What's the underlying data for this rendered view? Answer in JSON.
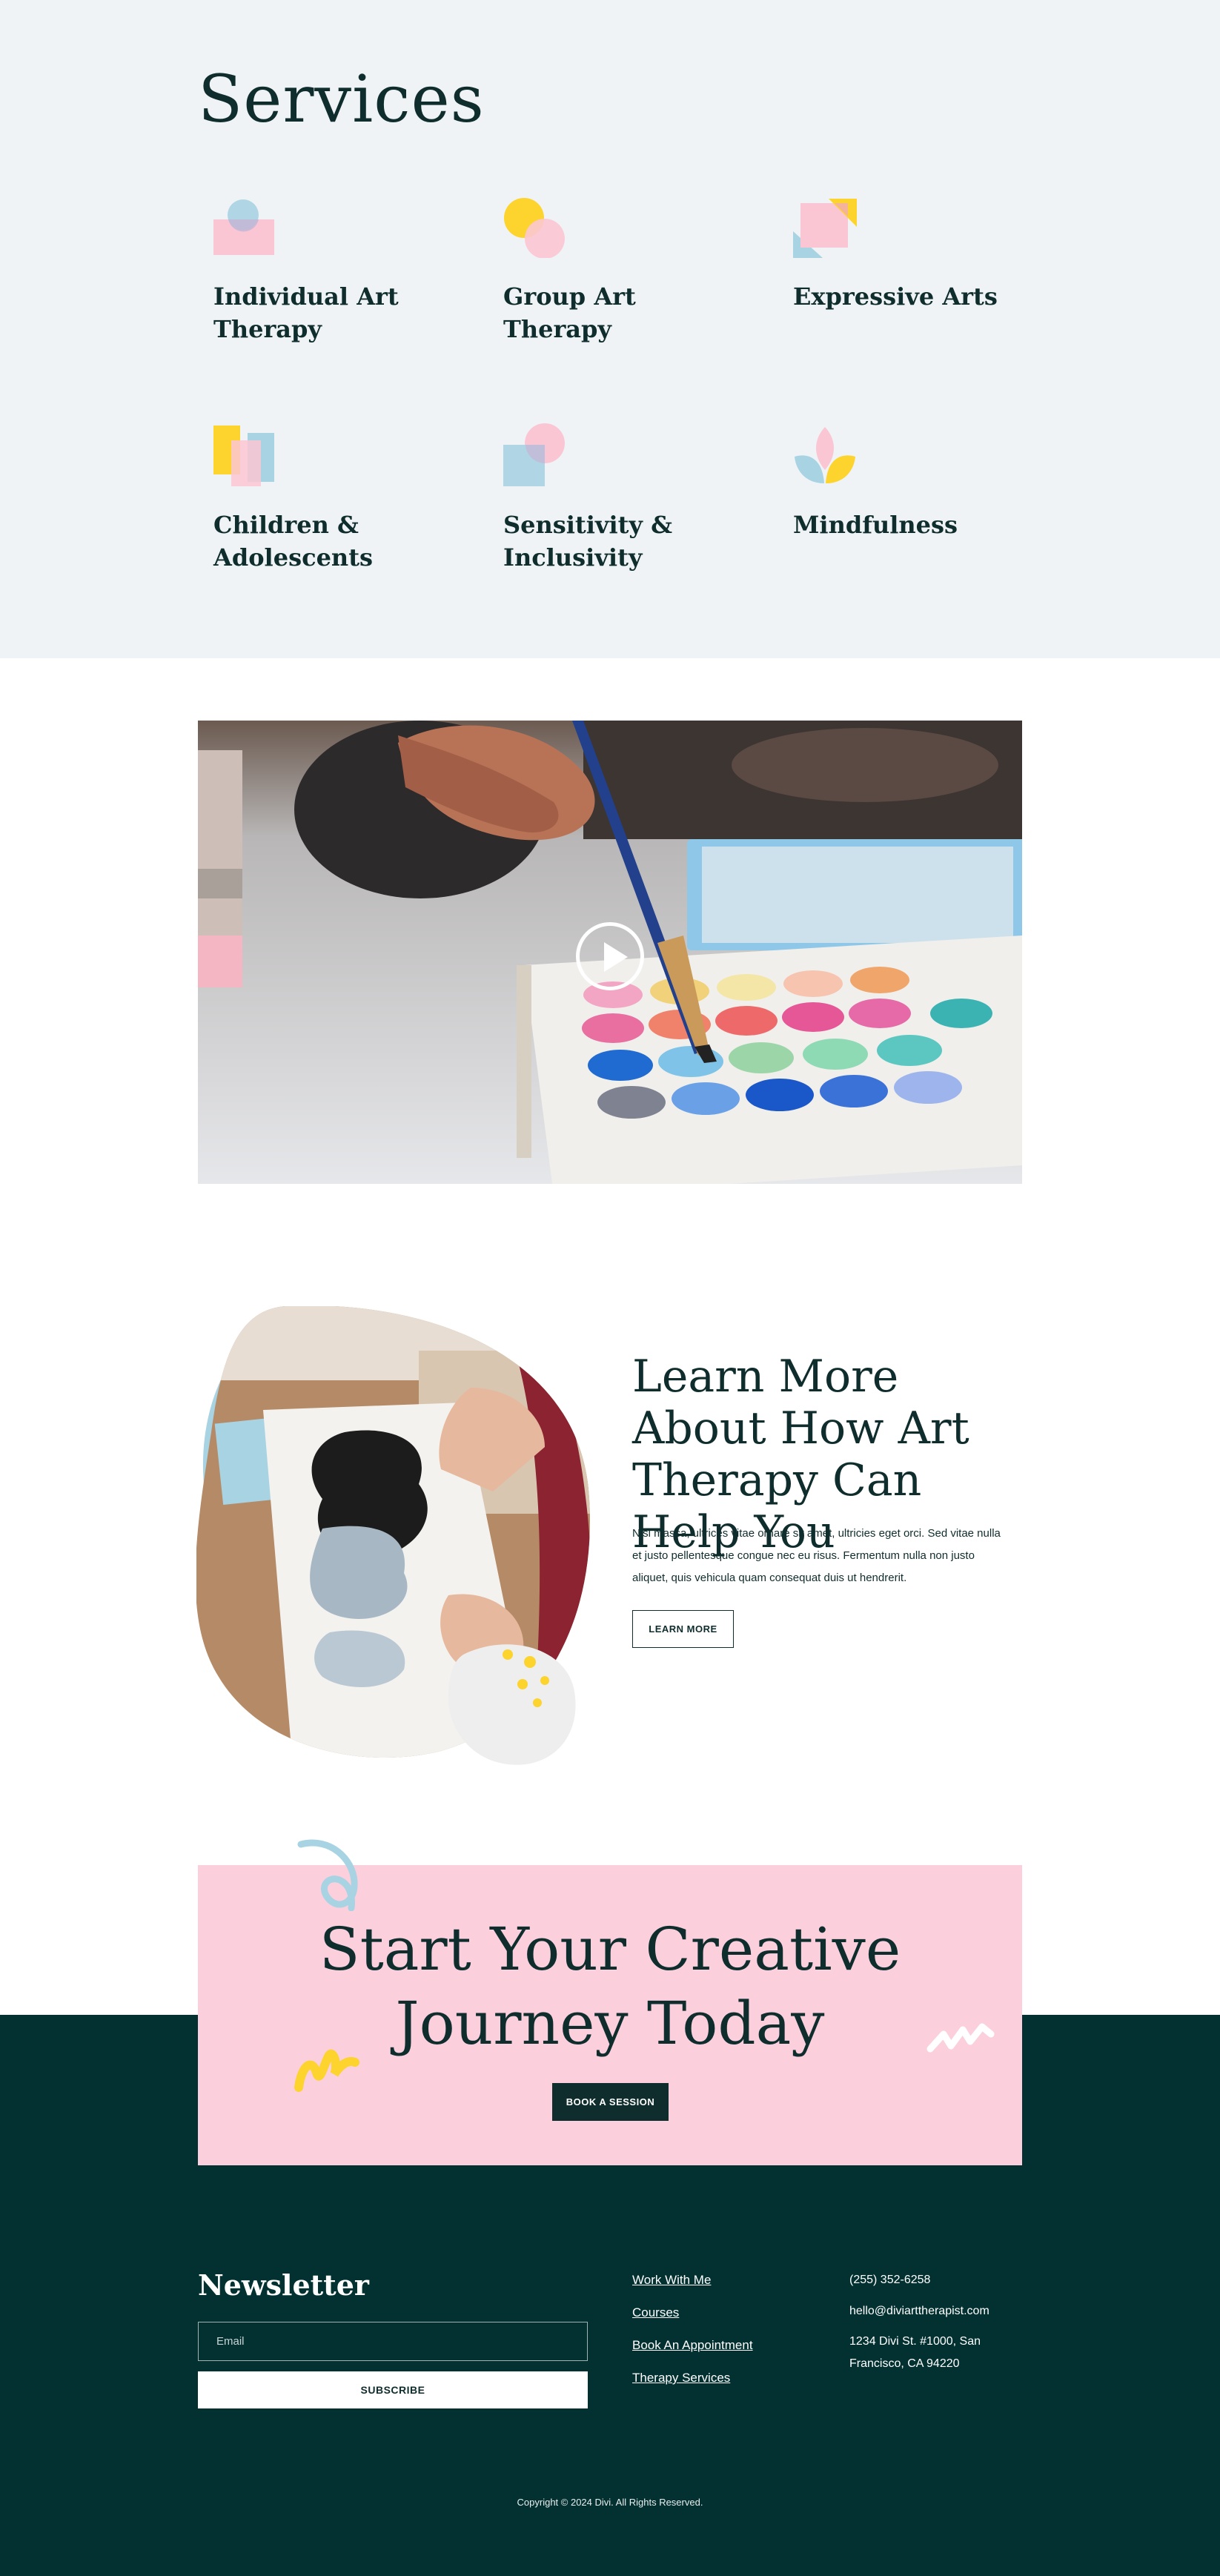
{
  "services": {
    "title": "Services",
    "items": [
      {
        "label": "Individual Art Therapy",
        "icon": "circle-square-icon"
      },
      {
        "label": "Group Art Therapy",
        "icon": "overlapping-circles-icon"
      },
      {
        "label": "Expressive Arts",
        "icon": "layered-squares-icon"
      },
      {
        "label": "Children & Adolescents",
        "icon": "overlapping-rectangles-icon"
      },
      {
        "label": "Sensitivity & Inclusivity",
        "icon": "square-circle-icon"
      },
      {
        "label": "Mindfulness",
        "icon": "lotus-icon"
      }
    ]
  },
  "video": {
    "play_icon": "play-icon"
  },
  "learn_more": {
    "heading": "Learn More About How Art Therapy Can Help You",
    "body": "Nisl massa, ultrices vitae ornare sit amet, ultricies eget orci. Sed vitae nulla et justo pellentesque congue nec eu risus. Fermentum nulla non justo aliquet, quis vehicula quam consequat duis ut hendrerit.",
    "button_label": "LEARN MORE"
  },
  "cta": {
    "heading": "Start Your Creative Journey Today",
    "button_label": "BOOK A SESSION"
  },
  "footer": {
    "newsletter_title": "Newsletter",
    "email_placeholder": "Email",
    "subscribe_label": "SUBSCRIBE",
    "links": [
      "Work With Me",
      "Courses",
      "Book An Appointment",
      "Therapy Services"
    ],
    "phone": "(255) 352-6258",
    "email": "hello@diviarttherapist.com",
    "address": "1234 Divi St. #1000, San Francisco, CA 94220",
    "copyright": "Copyright © 2024 Divi. All Rights Reserved."
  },
  "colors": {
    "dark_teal": "#0f2d2d",
    "footer_bg": "#033131",
    "pink": "#fbd0dc",
    "light_blue": "#a8d3e3",
    "yellow": "#fdd32e",
    "services_bg": "#f0f3f6"
  }
}
